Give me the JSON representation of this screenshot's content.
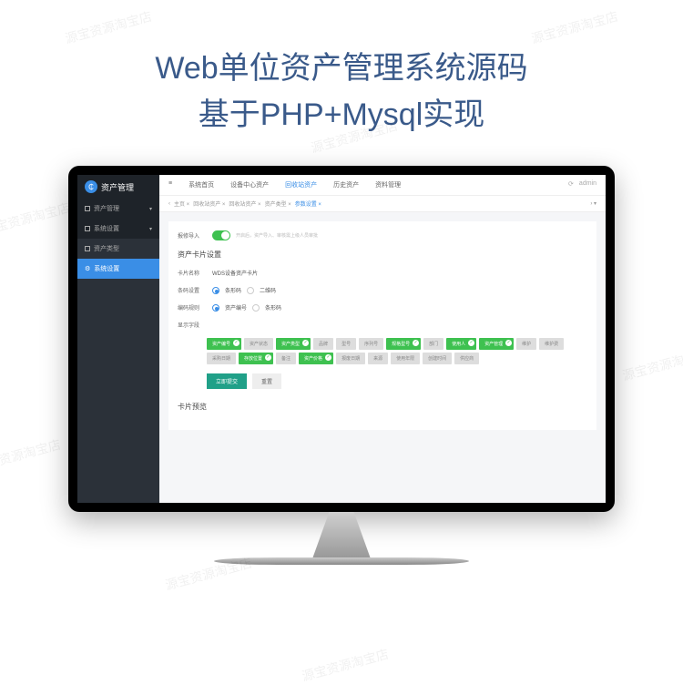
{
  "watermark": "源宝资源淘宝店",
  "hero": {
    "line1": "Web单位资产管理系统源码",
    "line2": "基于PHP+Mysql实现"
  },
  "sidebar": {
    "logo": "资产管理",
    "items": [
      {
        "label": "资产管理",
        "active": false
      },
      {
        "label": "系统设置",
        "active": false
      },
      {
        "label": "资产类型",
        "active": false
      },
      {
        "label": "系统设置",
        "active": true
      }
    ]
  },
  "topbar": {
    "menu": "≡",
    "tabs": [
      "系统首页",
      "设备中心资产",
      "回收站资产",
      "历史资产",
      "资料管理"
    ],
    "active_index": 2,
    "user": "admin"
  },
  "crumbs": [
    "主页",
    "回收站资产",
    "回收站资产",
    "资产类型",
    "参数设置"
  ],
  "content": {
    "approver_label": "报修导入",
    "approver_hint": "开启后，资产导入、审核需上级人员审批",
    "section_title": "资产卡片设置",
    "card_name_label": "卡片名称",
    "card_name_value": "WDS设备资产卡片",
    "code_label": "条码设置",
    "code_options": [
      "条形码",
      "二维码"
    ],
    "code_checked": 0,
    "num_label": "编码规则",
    "num_options": [
      "资产编号",
      "条形码"
    ],
    "num_checked": 0,
    "fields_label": "显示字段",
    "fields": [
      {
        "name": "资产编号",
        "on": true
      },
      {
        "name": "资产状态",
        "on": false
      },
      {
        "name": "资产类型",
        "on": true
      },
      {
        "name": "品牌",
        "on": false
      },
      {
        "name": "型号",
        "on": false
      },
      {
        "name": "序列号",
        "on": false
      },
      {
        "name": "规格型号",
        "on": true
      },
      {
        "name": "部门",
        "on": false
      },
      {
        "name": "使用人",
        "on": true
      },
      {
        "name": "资产管理",
        "on": true
      },
      {
        "name": "维护",
        "on": false
      },
      {
        "name": "维护费",
        "on": false
      },
      {
        "name": "采购日期",
        "on": false
      },
      {
        "name": "存放位置",
        "on": true
      },
      {
        "name": "备注",
        "on": false
      },
      {
        "name": "资产价格",
        "on": true
      },
      {
        "name": "报废日期",
        "on": false
      },
      {
        "name": "来源",
        "on": false
      },
      {
        "name": "使用年限",
        "on": false
      },
      {
        "name": "创建时间",
        "on": false
      },
      {
        "name": "供应商",
        "on": false
      }
    ],
    "btn_submit": "立即提交",
    "btn_reset": "重置",
    "preview_title": "卡片预览"
  }
}
